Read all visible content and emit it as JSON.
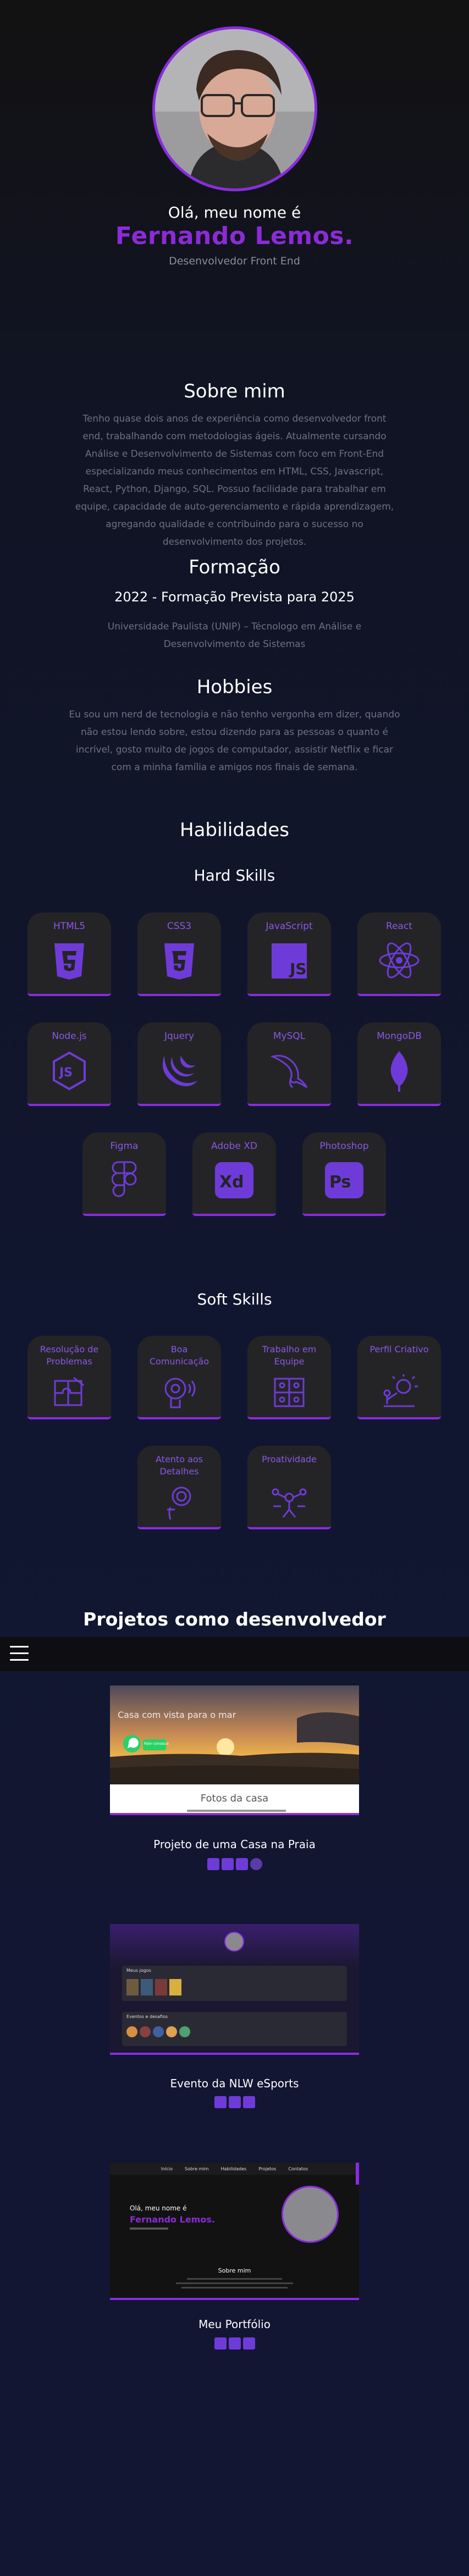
{
  "hero": {
    "greeting": "Olá, meu nome é",
    "name": "Fernando Lemos.",
    "role": "Desenvolvedor Front End"
  },
  "about": {
    "title": "Sobre mim",
    "text": "Tenho quase dois anos de experiência como desenvolvedor front end, trabalhando com metodologias ágeis. Atualmente cursando Análise e Desenvolvimento de Sistemas com foco em Front-End especializando meus conhecimentos em HTML, CSS, Javascript, React, Python, Django, SQL. Possuo facilidade para trabalhar em equipe, capacidade de auto-gerenciamento e rápida aprendizagem, agregando qualidade e contribuindo para o sucesso no desenvolvimento dos projetos."
  },
  "education": {
    "title": "Formação",
    "period": "2022 - Formação Prevista para 2025",
    "institution": "Universidade Paulista (UNIP) – Técnologo em Análise e Desenvolvimento de Sistemas"
  },
  "hobbies": {
    "title": "Hobbies",
    "text": "Eu sou um nerd de tecnologia e não tenho vergonha em dizer, quando não estou lendo sobre, estou dizendo para as pessoas o quanto é incrível, gosto muito de jogos de computador, assistir Netflix e ficar com a minha família e amigos nos finais de semana."
  },
  "skills": {
    "title": "Habilidades",
    "hard_title": "Hard Skills",
    "hard": [
      "HTML5",
      "CSS3",
      "JavaScript",
      "React",
      "Node.js",
      "Jquery",
      "MySQL",
      "MongoDB",
      "Figma",
      "Adobe XD",
      "Photoshop"
    ],
    "soft_title": "Soft Skills",
    "soft": [
      "Resolução de Problemas",
      "Boa Comunicação",
      "Trabalho em Equipe",
      "Perfil Criativo",
      "Atento aos Detalhes",
      "Proatividade"
    ]
  },
  "projects": {
    "title": "Projetos como desenvolvedor",
    "items": [
      {
        "name": "Projeto de uma Casa na Praia",
        "hero_text": "Casa com vista para o mar",
        "whatsapp_label": "Fale conosco",
        "caption": "Fotos da casa"
      },
      {
        "name": "Evento da NLW eSports",
        "section_a": "Meus jogos",
        "section_b": "Eventos e desafios"
      },
      {
        "name": "Meu Portfólio",
        "nav": [
          "Início",
          "Sobre mim",
          "Habilidades",
          "Projetos",
          "Contatos"
        ],
        "mini_greeting": "Olá, meu nome é",
        "mini_name": "Fernando Lemos.",
        "mini_about": "Sobre mim"
      }
    ]
  },
  "colors": {
    "accent": "#8a2be2",
    "card": "#242426",
    "label": "#8a57e8"
  }
}
